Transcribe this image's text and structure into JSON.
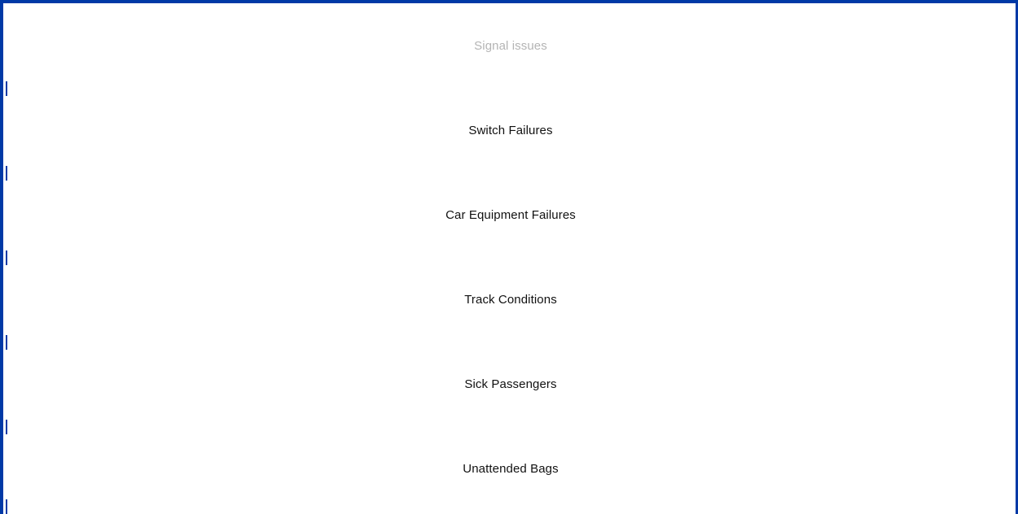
{
  "list": {
    "items": [
      {
        "label": "Signal issues",
        "state": "muted"
      },
      {
        "label": "Switch Failures",
        "state": "normal"
      },
      {
        "label": "Car Equipment Failures",
        "state": "normal"
      },
      {
        "label": "Track Conditions",
        "state": "normal"
      },
      {
        "label": "Sick Passengers",
        "state": "normal"
      },
      {
        "label": "Unattended Bags",
        "state": "normal"
      }
    ]
  },
  "colors": {
    "accent": "#0039a6",
    "text": "#111111",
    "muted_text": "#b4b4b4",
    "background": "#ffffff"
  }
}
